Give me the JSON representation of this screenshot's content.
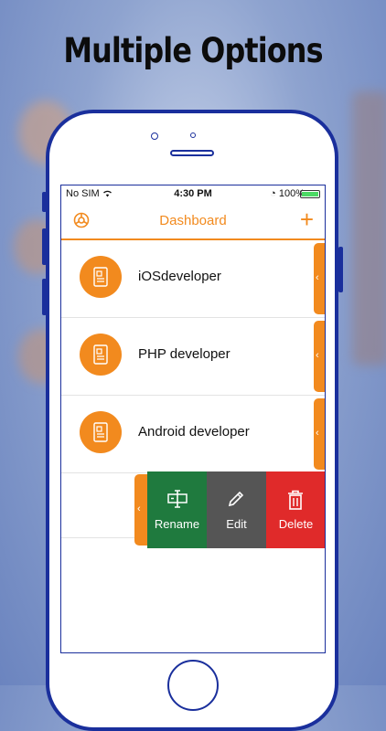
{
  "headline": "Multiple Options",
  "status_bar": {
    "carrier": "No SIM",
    "time": "4:30 PM",
    "battery": "100%"
  },
  "nav": {
    "title": "Dashboard",
    "add_label": "+"
  },
  "rows": [
    {
      "label": "iOSdeveloper"
    },
    {
      "label": "PHP developer"
    },
    {
      "label": "Android developer"
    }
  ],
  "actions": {
    "rename": "Rename",
    "edit": "Edit",
    "delete": "Delete"
  },
  "colors": {
    "accent": "#f28a1e",
    "rename": "#1f7a3e",
    "edit": "#555555",
    "delete": "#e02a2a",
    "frame": "#1a2f9c"
  }
}
